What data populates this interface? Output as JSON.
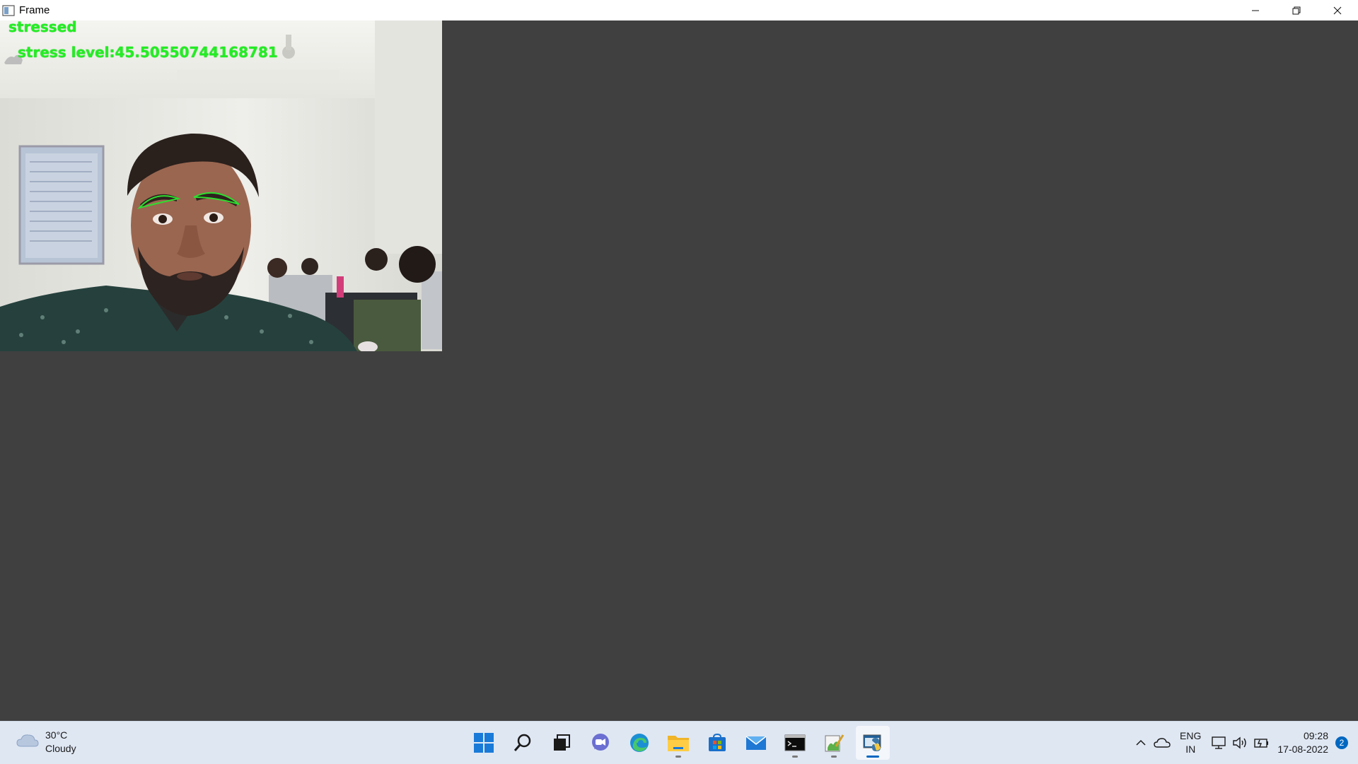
{
  "window": {
    "title": "Frame",
    "controls": [
      "minimize-icon",
      "restore-icon",
      "close-icon"
    ]
  },
  "frame": {
    "status_text": "stressed",
    "stress_text": "stress level:45.50550744168781",
    "overlay_color": "#22ee22"
  },
  "taskbar": {
    "weather": {
      "temperature": "30°C",
      "condition": "Cloudy",
      "icon": "cloud-icon"
    },
    "apps": [
      {
        "name": "start-icon"
      },
      {
        "name": "search-icon"
      },
      {
        "name": "task-view-icon"
      },
      {
        "name": "teams-chat-icon"
      },
      {
        "name": "edge-icon"
      },
      {
        "name": "file-explorer-icon"
      },
      {
        "name": "store-icon"
      },
      {
        "name": "mail-icon"
      },
      {
        "name": "terminal-icon"
      },
      {
        "name": "notepad-icon"
      },
      {
        "name": "python-icon"
      }
    ],
    "tray": {
      "lang_primary": "ENG",
      "lang_secondary": "IN",
      "time": "09:28",
      "date": "17-08-2022",
      "notifications": "2"
    }
  }
}
